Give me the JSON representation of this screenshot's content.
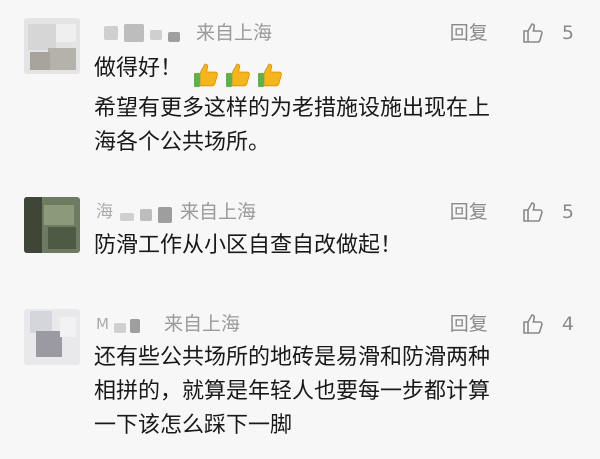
{
  "comments": [
    {
      "name_text": "",
      "location": "来自上海",
      "reply_label": "回复",
      "likes": "5",
      "lines": [
        "做得好！",
        "希望有更多这样的为老措施设施出现在上",
        "海各个公共场所。"
      ],
      "emoji_icon": "thumbs-up-emoji"
    },
    {
      "name_text": "海",
      "location": "来自上海",
      "reply_label": "回复",
      "likes": "5",
      "lines": [
        "防滑工作从小区自查自改做起！"
      ]
    },
    {
      "name_text": "M",
      "location": "来自上海",
      "reply_label": "回复",
      "likes": "4",
      "lines": [
        "还有些公共场所的地砖是易滑和防滑两种",
        "相拼的，就算是年轻人也要每一步都计算",
        "一下该怎么踩下一脚"
      ]
    }
  ],
  "colors": {
    "background": "#f7f7f7",
    "text": "#191919",
    "meta": "#9a9a9a",
    "emoji_yellow": "#f5b51f",
    "emoji_cuff": "#5fb24a"
  },
  "icons": {
    "like": "thumbs-up-outline-icon"
  }
}
